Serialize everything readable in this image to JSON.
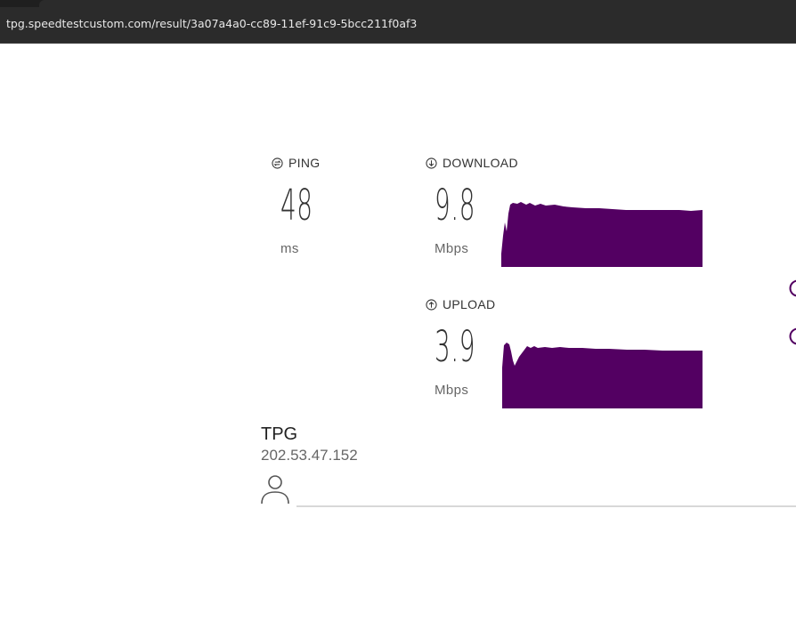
{
  "browser": {
    "url": "tpg.speedtestcustom.com/result/3a07a4a0-cc89-11ef-91c9-5bcc211f0af3"
  },
  "results": {
    "ping": {
      "label": "PING",
      "value": "48",
      "unit": "ms",
      "icon": "ping-icon"
    },
    "download": {
      "label": "DOWNLOAD",
      "value": "9.8",
      "unit": "Mbps",
      "icon": "download-arrow-icon"
    },
    "upload": {
      "label": "UPLOAD",
      "value": "3.9",
      "unit": "Mbps",
      "icon": "upload-arrow-icon"
    }
  },
  "provider": {
    "name": "TPG",
    "ip": "202.53.47.152"
  },
  "colors": {
    "graph_fill": "#530062",
    "accent": "#530062",
    "text_dark": "#333333",
    "text_muted": "#666666",
    "address_bar": "#2b2b2b"
  }
}
